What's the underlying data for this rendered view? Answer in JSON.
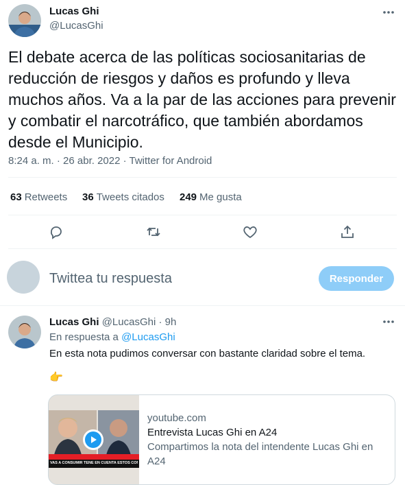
{
  "tweet": {
    "author_name": "Lucas Ghi",
    "author_handle": "@LucasGhi",
    "text_lines": [
      "El debate acerca de las políticas sociosanitarias de",
      "reducción de riesgos y daños es profundo y lleva",
      "muchos años. Va a la par de las acciones para prevenir",
      "y combatir el narcotráfico, que también abordamos",
      "desde el Municipio."
    ],
    "timestamp": "8:24 a. m. · 26 abr. 2022 · Twitter for Android"
  },
  "stats": {
    "retweets_count": "63",
    "retweets_label": "Retweets",
    "quotes_count": "36",
    "quotes_label": "Tweets citados",
    "likes_count": "249",
    "likes_label": "Me gusta"
  },
  "actions": [
    "reply-icon",
    "retweet-icon",
    "like-icon",
    "share-icon"
  ],
  "compose": {
    "placeholder": "Twittea tu respuesta",
    "button_label": "Responder"
  },
  "reply": {
    "author_name": "Lucas Ghi",
    "author_handle": "@LucasGhi",
    "time": "· 9h",
    "replying_prefix": "En respuesta a",
    "replying_handle": "@LucasGhi",
    "text": "En esta nota pudimos conversar con bastante claridad sobre el tema.",
    "emoji": "👉",
    "card": {
      "domain": "youtube.com",
      "title": "Entrevista Lucas Ghi en A24",
      "description": "Compartimos la nota del intendente Lucas Ghi en A24",
      "thumb_caption": "VAS A CONSUMIR TENÉ EN CUENTA ESTOS CONSEJOS"
    }
  },
  "colors": {
    "accent": "#1d9bf0",
    "button_disabled": "#8ecdf8",
    "text_secondary": "#536471",
    "divider": "#eff3f4"
  }
}
